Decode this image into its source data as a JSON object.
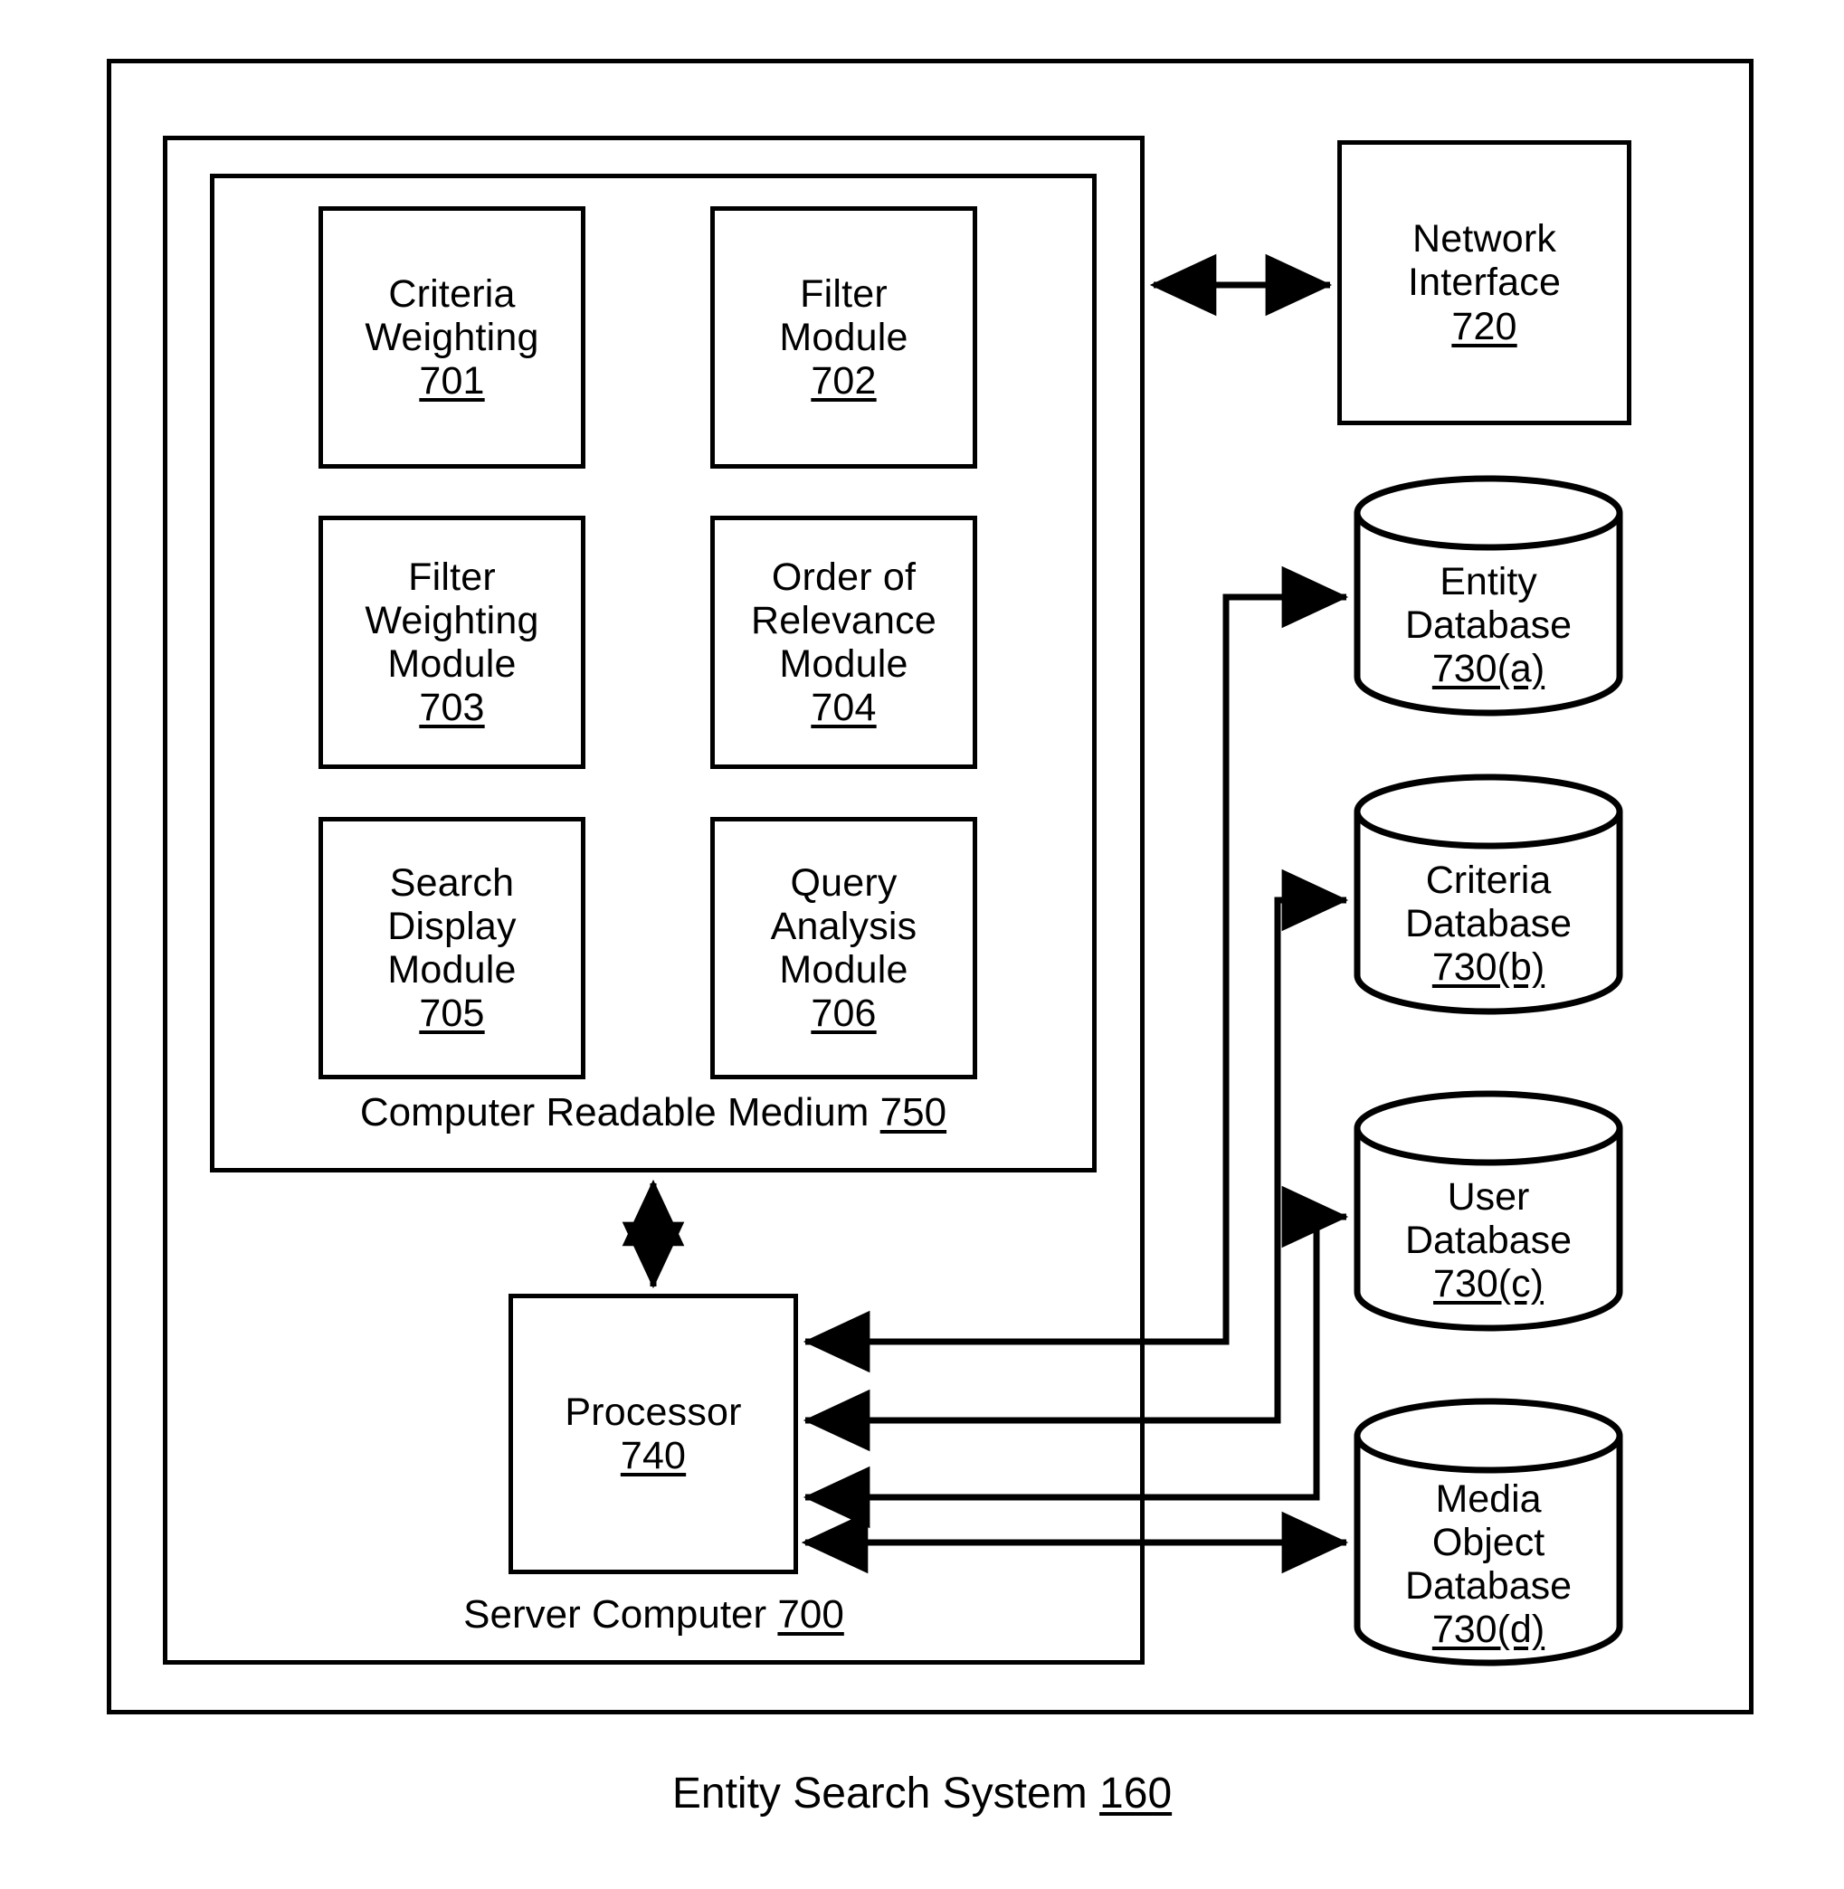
{
  "figure": {
    "caption_text": "Entity Search System",
    "caption_number": "160"
  },
  "outer_box": {
    "name": "entity-search-system-boundary"
  },
  "server_computer": {
    "label_text": "Server Computer",
    "label_number": "700"
  },
  "computer_readable_medium": {
    "label_text": "Computer Readable Medium",
    "label_number": "750"
  },
  "modules": [
    {
      "line1": "Criteria",
      "line2": "Weighting",
      "line3": "",
      "number": "701",
      "name": "criteria-weighting-module"
    },
    {
      "line1": "Filter",
      "line2": "Module",
      "line3": "",
      "number": "702",
      "name": "filter-module"
    },
    {
      "line1": "Filter",
      "line2": "Weighting",
      "line3": "Module",
      "number": "703",
      "name": "filter-weighting-module"
    },
    {
      "line1": "Order of",
      "line2": "Relevance",
      "line3": "Module",
      "number": "704",
      "name": "order-of-relevance-module"
    },
    {
      "line1": "Search",
      "line2": "Display",
      "line3": "Module",
      "number": "705",
      "name": "search-display-module"
    },
    {
      "line1": "Query",
      "line2": "Analysis",
      "line3": "Module",
      "number": "706",
      "name": "query-analysis-module"
    }
  ],
  "processor": {
    "label_text": "Processor",
    "label_number": "740"
  },
  "network_interface": {
    "line1": "Network",
    "line2": "Interface",
    "number": "720"
  },
  "databases": [
    {
      "line1": "Entity",
      "line2": "Database",
      "line3": "",
      "number": "730(a)",
      "name": "entity-database"
    },
    {
      "line1": "Criteria",
      "line2": "Database",
      "line3": "",
      "number": "730(b)",
      "name": "criteria-database"
    },
    {
      "line1": "User",
      "line2": "Database",
      "line3": "",
      "number": "730(c)",
      "name": "user-database"
    },
    {
      "line1": "Media",
      "line2": "Object",
      "line3": "Database",
      "number": "730(d)",
      "name": "media-object-database"
    }
  ],
  "colors": {
    "stroke": "#000000",
    "background": "#ffffff"
  }
}
